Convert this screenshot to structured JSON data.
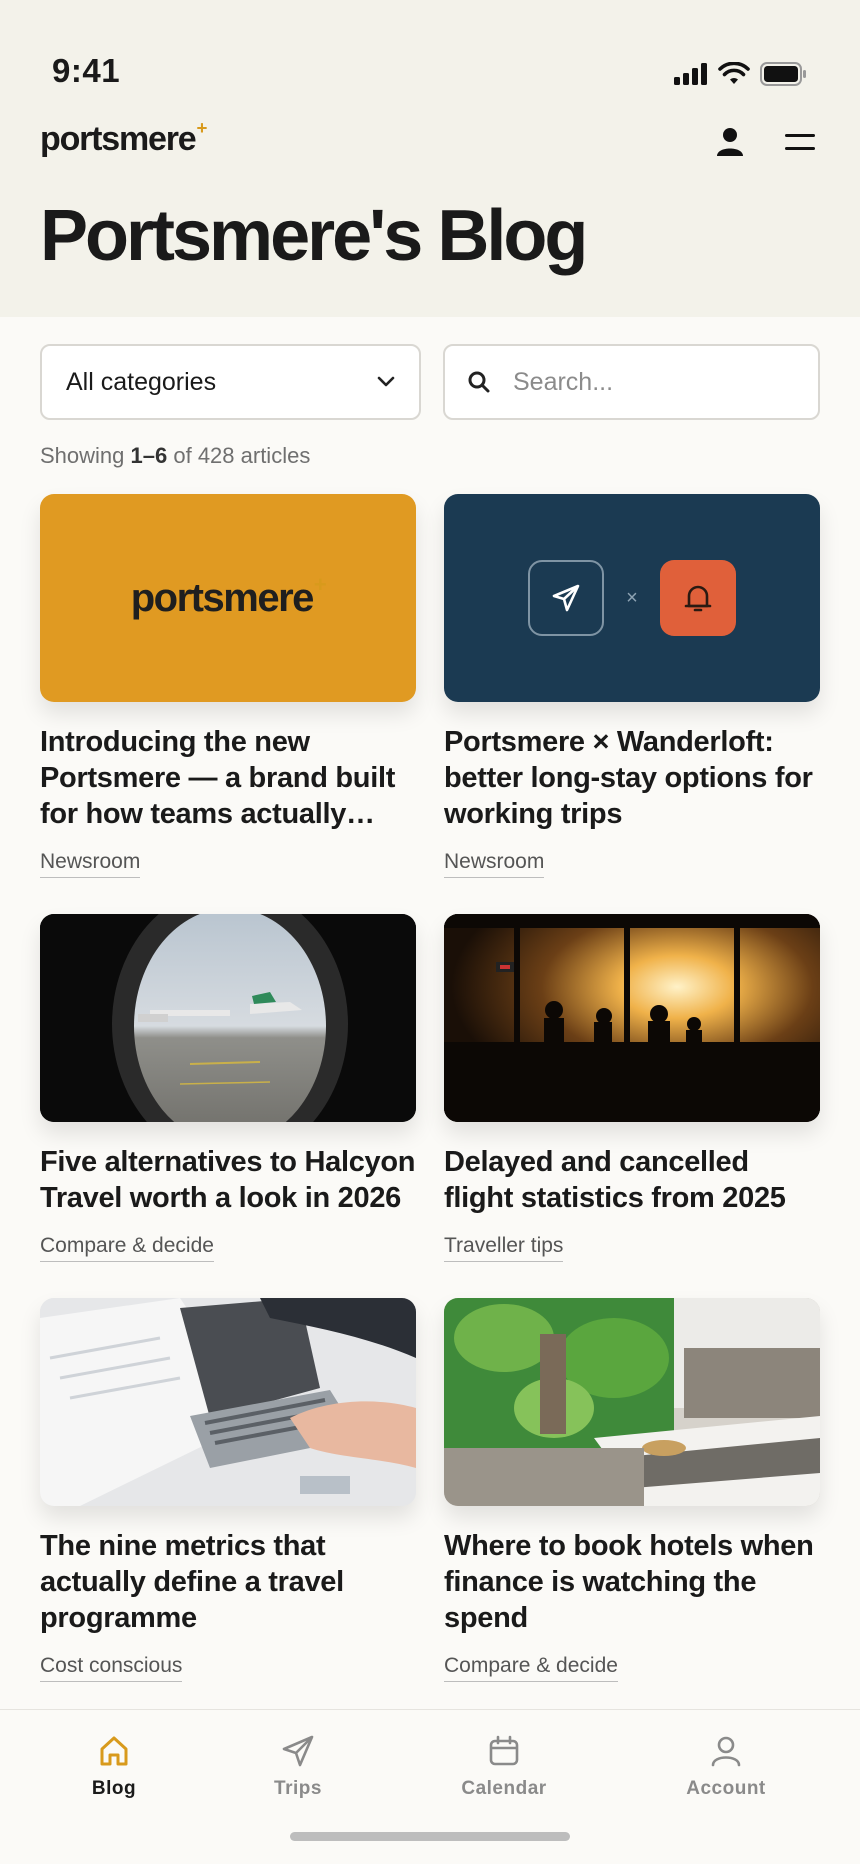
{
  "status": {
    "time": "9:41"
  },
  "brand": {
    "name": "portsmere",
    "mark": "+"
  },
  "page": {
    "title": "Portsmere's Blog"
  },
  "filters": {
    "category_selected": "All categories",
    "search_placeholder": "Search..."
  },
  "results": {
    "prefix": "Showing",
    "range": "1–6",
    "suffix": "of 428 articles"
  },
  "articles": [
    {
      "title": "Introducing the new Portsmere — a brand built for how teams actually…",
      "category": "Newsroom",
      "image": "brand-logo-tile"
    },
    {
      "title": "Portsmere × Wanderloft: better long-stay options for working trips",
      "category": "Newsroom",
      "image": "partnership-tile",
      "separator": "×"
    },
    {
      "title": "Five alternatives to Halcyon Travel worth a look in 2026",
      "category": "Compare & decide",
      "image": "airplane-window-photo"
    },
    {
      "title": "Delayed and cancelled flight statistics from 2025",
      "category": "Traveller tips",
      "image": "airport-lounge-sunset-photo"
    },
    {
      "title": "The nine metrics that actually define a travel programme",
      "category": "Cost conscious",
      "image": "laptop-paperwork-photo"
    },
    {
      "title": "Where to book hotels when finance is watching the spend",
      "category": "Compare & decide",
      "image": "hotel-room-photo"
    }
  ],
  "tabs": [
    {
      "label": "Blog",
      "icon": "home-icon",
      "active": true
    },
    {
      "label": "Trips",
      "icon": "paper-plane-icon"
    },
    {
      "label": "Calendar",
      "icon": "calendar-icon"
    },
    {
      "label": "Account",
      "icon": "user-icon"
    }
  ],
  "colors": {
    "accent": "#d89a1c",
    "header_bg": "#f3f2ea",
    "card_yellow": "#e09a22",
    "card_navy": "#1b3a52",
    "card_orange": "#e0603a"
  }
}
